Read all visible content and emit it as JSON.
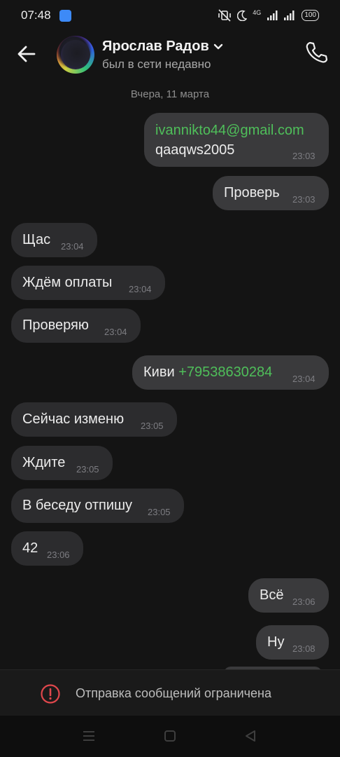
{
  "status_bar": {
    "time": "07:48",
    "network": "4G",
    "battery": "100",
    "icons": [
      "app-notification-icon",
      "vibrate-off-icon",
      "do-not-disturb-moon-icon",
      "signal-icon",
      "signal-icon-2",
      "battery-icon"
    ]
  },
  "header": {
    "contact_name": "Ярослав Радов",
    "status": "был в сети недавно",
    "icons": [
      "back-arrow-icon",
      "chevron-down-icon",
      "phone-icon"
    ]
  },
  "date_separator": "Вчера, 11 марта",
  "messages": [
    {
      "direction": "out",
      "link": "ivannikto44@gmail.com",
      "text": "qaaqws2005",
      "time": "23:03"
    },
    {
      "direction": "out",
      "text": "Проверь",
      "time": "23:03"
    },
    {
      "direction": "in",
      "text": "Щас",
      "time": "23:04"
    },
    {
      "direction": "in",
      "text": "Ждём оплаты",
      "time": "23:04"
    },
    {
      "direction": "in",
      "text": "Проверяю",
      "time": "23:04"
    },
    {
      "direction": "out",
      "text": "Киви ",
      "link": "+79538630284",
      "time": "23:04"
    },
    {
      "direction": "in",
      "text": "Сейчас изменю",
      "time": "23:05"
    },
    {
      "direction": "in",
      "text": "Ждите",
      "time": "23:05"
    },
    {
      "direction": "in",
      "text": "В беседу отпишу",
      "time": "23:05"
    },
    {
      "direction": "in",
      "text": "42",
      "time": "23:06"
    },
    {
      "direction": "out",
      "text": "Всё",
      "time": "23:06"
    },
    {
      "direction": "out",
      "text": "Ну",
      "time": "23:08"
    }
  ],
  "restriction_notice": "Отправка сообщений ограничена",
  "colors": {
    "background": "#141414",
    "incoming_bubble": "#2c2c2e",
    "outgoing_bubble": "#3a3a3c",
    "link": "#4fbf5a",
    "warning": "#e0474c"
  },
  "nav_icons": [
    "menu-icon",
    "home-square-icon",
    "back-triangle-icon"
  ]
}
